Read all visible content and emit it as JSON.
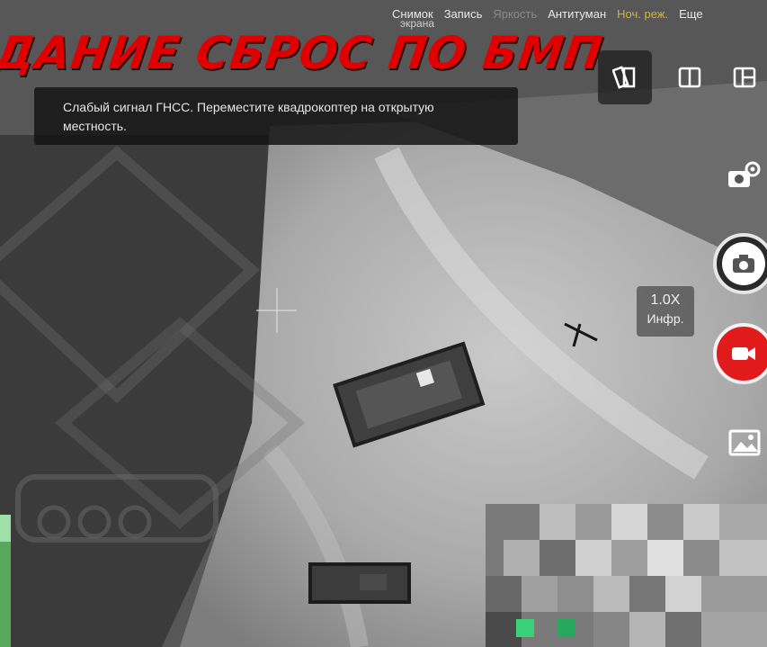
{
  "banner": {
    "text": "ДАНИЕ СБРОС ПО БМП"
  },
  "top_menu": {
    "items": [
      {
        "label": "Снимок",
        "state": "normal"
      },
      {
        "label": "Запись",
        "state": "normal"
      },
      {
        "label": "Яркость",
        "state": "dim"
      },
      {
        "label": "Антитуман",
        "state": "normal"
      },
      {
        "label": "Ноч. реж.",
        "state": "active"
      },
      {
        "label": "Еще",
        "state": "normal"
      }
    ],
    "subtext": "экрана"
  },
  "toast": {
    "message": "Слабый сигнал ГНСС. Переместите квадрокоптер на открытую местность."
  },
  "layout_buttons": [
    {
      "icon": "split-screen-icon",
      "selected": true
    },
    {
      "icon": "two-column-icon",
      "selected": false
    },
    {
      "icon": "grid-layout-icon",
      "selected": false
    }
  ],
  "camera": {
    "zoom": "1.0X",
    "mode": "Инфр."
  },
  "colors": {
    "accent_active": "#d8b52a",
    "record_red": "#e11b1b",
    "banner_red": "#e00000"
  }
}
